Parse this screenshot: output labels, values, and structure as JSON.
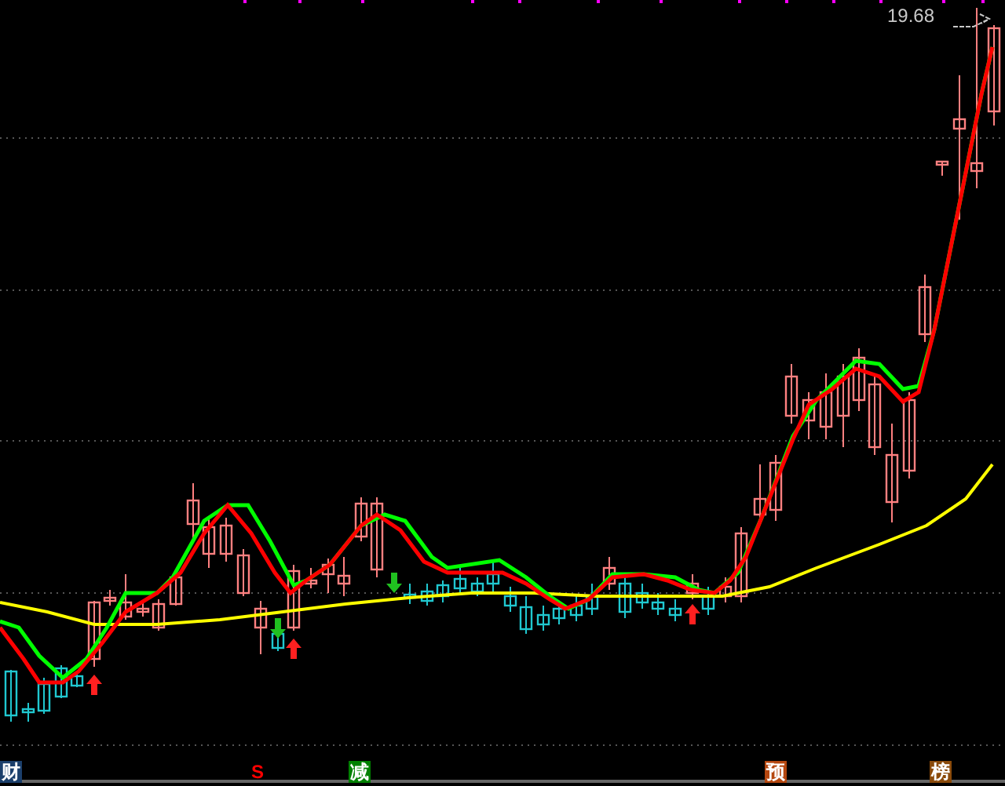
{
  "price_label": "19.68",
  "markers": [
    {
      "label": "财",
      "kind": "filled",
      "color": "#1b3f6b"
    },
    {
      "label": "S",
      "kind": "plain",
      "color": "#ff0000"
    },
    {
      "label": "减",
      "kind": "filled",
      "color": "#008000"
    },
    {
      "label": "预",
      "kind": "filled",
      "color": "#b5470f"
    },
    {
      "label": "榜",
      "kind": "filled",
      "color": "#8a4a0a"
    }
  ]
}
